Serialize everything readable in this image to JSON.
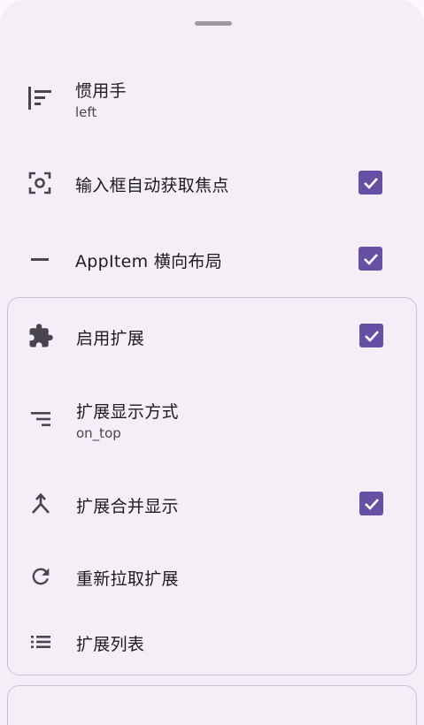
{
  "settings": {
    "handedness": {
      "title": "惯用手",
      "value": "left",
      "icon": "align-left-icon"
    },
    "autofocus": {
      "title": "输入框自动获取焦点",
      "checked": true,
      "icon": "focus-center-icon"
    },
    "appitem_horizontal": {
      "title": "AppItem 横向布局",
      "checked": true,
      "icon": "horizontal-rule-icon"
    }
  },
  "extensions": {
    "enable": {
      "title": "启用扩展",
      "checked": true,
      "icon": "extension-puzzle-icon"
    },
    "display_mode": {
      "title": "扩展显示方式",
      "value": "on_top",
      "icon": "sort-lines-icon"
    },
    "merge_display": {
      "title": "扩展合并显示",
      "checked": true,
      "icon": "merge-icon"
    },
    "refetch": {
      "title": "重新拉取扩展",
      "icon": "refresh-icon"
    },
    "list": {
      "title": "扩展列表",
      "icon": "list-icon"
    }
  },
  "colors": {
    "accent": "#6750a4",
    "surface": "#f4eff6",
    "outline": "#cac4d0"
  }
}
